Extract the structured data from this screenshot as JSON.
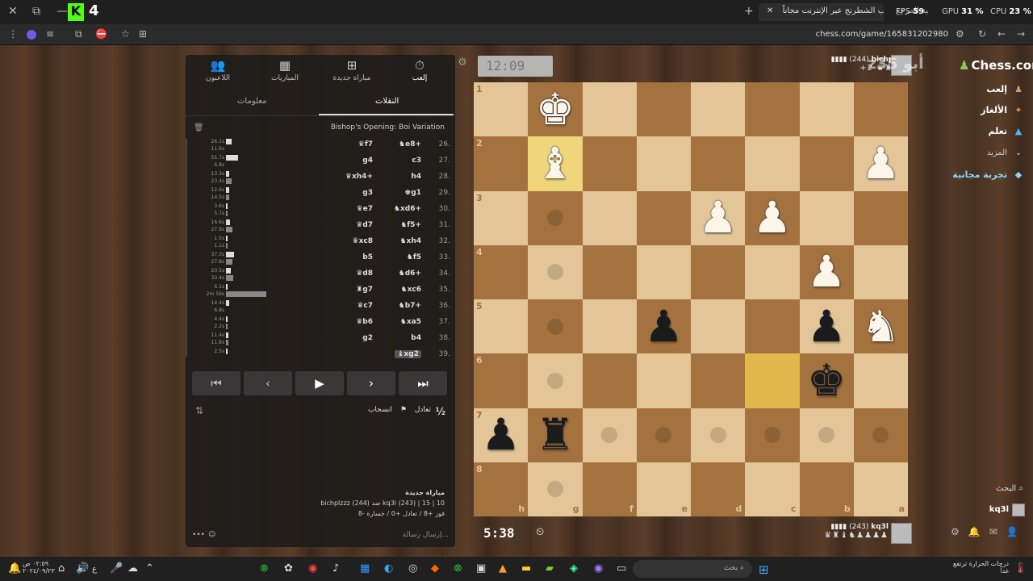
{
  "browser": {
    "tabs": [
      {
        "label": "إلعب الشطرنج عبر الإنترنت مجاناً"
      },
      {
        "label": "بنية المرجع"
      }
    ],
    "url": "chess.com/game/165831202980",
    "hud": {
      "fps_label": "FPS",
      "fps_value": "59",
      "gpu_label": "GPU",
      "gpu_value": "31 %",
      "cpu_label": "CPU",
      "cpu_value": "23 %"
    },
    "kick_badge": "4"
  },
  "panel": {
    "nav": [
      {
        "label": "إلعب",
        "icon": "timer-icon"
      },
      {
        "label": "مباراة جديدة",
        "icon": "plus-icon"
      },
      {
        "label": "المباريات",
        "icon": "board-icon"
      },
      {
        "label": "اللاعبون",
        "icon": "players-icon"
      }
    ],
    "subtabs": {
      "moves": "النقلات",
      "info": "معلومات"
    },
    "opening": "Bishop's Opening: Boi Variation",
    "moves": [
      {
        "no": "26.",
        "w": "♞e8+",
        "b": "♛f7"
      },
      {
        "no": "27.",
        "w": "c3",
        "b": "g4"
      },
      {
        "no": "28.",
        "w": "h4",
        "b": "♛xh4+"
      },
      {
        "no": "29.",
        "w": "♚g1",
        "b": "g3"
      },
      {
        "no": "30.",
        "w": "♞xd6+",
        "b": "♛e7"
      },
      {
        "no": "31.",
        "w": "♞f5+",
        "b": "♛d7"
      },
      {
        "no": "32.",
        "w": "♞xh4",
        "b": "♛xc8"
      },
      {
        "no": "33.",
        "w": "♞f5",
        "b": "b5"
      },
      {
        "no": "34.",
        "w": "♞d6+",
        "b": "♛d8"
      },
      {
        "no": "35.",
        "w": "♞xc6",
        "b": "♜g7"
      },
      {
        "no": "36.",
        "w": "♞b7+",
        "b": "♛c7"
      },
      {
        "no": "37.",
        "w": "♞xa5",
        "b": "♛b6"
      },
      {
        "no": "38.",
        "w": "b4",
        "b": "g2"
      },
      {
        "no": "39.",
        "w": "♝xg2",
        "b": ""
      }
    ],
    "times": [
      {
        "a": "26.1s",
        "b": "11.6s",
        "fa": 0.14,
        "fb": 0
      },
      {
        "a": "55.7s",
        "b": "6.8s",
        "fa": 0.3,
        "fb": 0
      },
      {
        "a": "13.3s",
        "b": "23.4s",
        "fa": 0.07,
        "fb": 0.13
      },
      {
        "a": "12.6s",
        "b": "14.5s",
        "fa": 0.07,
        "fb": 0.08
      },
      {
        "a": "3.6s",
        "b": "5.7s",
        "fa": 0.02,
        "fb": 0.03
      },
      {
        "a": "16.6s",
        "b": "27.9s",
        "fa": 0.09,
        "fb": 0.15
      },
      {
        "a": "1.5s",
        "b": "1.1s",
        "fa": 0.01,
        "fb": 0.01
      },
      {
        "a": "37.3s",
        "b": "27.8s",
        "fa": 0.2,
        "fb": 0.15
      },
      {
        "a": "20.5s",
        "b": "33.4s",
        "fa": 0.11,
        "fb": 0.18
      },
      {
        "a": "6.1s",
        "b": "2m 59s",
        "fa": 0.03,
        "fb": 1.0
      },
      {
        "a": "14.4s",
        "b": "6.8s",
        "fa": 0.08,
        "fb": 0
      },
      {
        "a": "4.4s",
        "b": "2.2s",
        "fa": 0.02,
        "fb": 0.01
      },
      {
        "a": "11.4s",
        "b": "11.8s",
        "fa": 0.06,
        "fb": 0.06
      },
      {
        "a": "2.5s",
        "b": "",
        "fa": 0.01,
        "fb": 0
      }
    ],
    "controls": {
      "first": "⏮",
      "prev": "‹",
      "play": "▶",
      "next": "›",
      "last": "⏭"
    },
    "draw_label": "تعادل",
    "draw_icon": "½",
    "resign_label": "انسحاب",
    "game_info": {
      "title": "مباراة جديدة",
      "line1": "bichplzzz (244) ضد kq3l (243) | 15 | 10",
      "line2": "فوز +8 / تعادل +0 / خسارة -8"
    },
    "chat_placeholder": "إرسال رسالة..."
  },
  "board": {
    "ranks": [
      "1",
      "2",
      "3",
      "4",
      "5",
      "6",
      "7",
      "8"
    ],
    "files": [
      "h",
      "g",
      "f",
      "e",
      "d",
      "c",
      "b",
      "a"
    ],
    "pieces": [
      {
        "sq": "0,1",
        "glyph": "♚",
        "color": "w"
      },
      {
        "sq": "1,1",
        "glyph": "♝",
        "color": "w"
      },
      {
        "sq": "1,7",
        "glyph": "♟",
        "color": "w"
      },
      {
        "sq": "2,4",
        "glyph": "♟",
        "color": "w"
      },
      {
        "sq": "2,5",
        "glyph": "♟",
        "color": "w"
      },
      {
        "sq": "3,6",
        "glyph": "♟",
        "color": "w"
      },
      {
        "sq": "4,3",
        "glyph": "♟",
        "color": "b"
      },
      {
        "sq": "4,6",
        "glyph": "♟",
        "color": "b"
      },
      {
        "sq": "4,7",
        "glyph": "♞",
        "color": "w"
      },
      {
        "sq": "5,6",
        "glyph": "♚",
        "color": "b"
      },
      {
        "sq": "6,0",
        "glyph": "♟",
        "color": "b"
      },
      {
        "sq": "6,1",
        "glyph": "♜",
        "color": "b"
      }
    ],
    "highlights": [
      "1,1",
      "5,5"
    ],
    "hints": [
      "2,1",
      "3,1",
      "4,1",
      "5,1",
      "6,2",
      "6,3",
      "6,4",
      "6,5",
      "6,6",
      "6,7",
      "7,1"
    ]
  },
  "players": {
    "top": {
      "name": "bichplzzz",
      "rating": "(244)",
      "material": "+2",
      "clock": "12:09"
    },
    "bottom": {
      "name": "kq3l",
      "rating": "(243)",
      "clock": "5:38"
    }
  },
  "sidebar": {
    "logo": "Chess.com",
    "items": [
      {
        "label": "إلعب",
        "icon": "pawn-icon"
      },
      {
        "label": "الألغاز",
        "icon": "puzzle-icon"
      },
      {
        "label": "تعلم",
        "icon": "cap-icon"
      },
      {
        "label": "المزيد",
        "icon": "chevron-icon"
      },
      {
        "label": "تجربة مجانية",
        "icon": "diamond-icon"
      }
    ],
    "search": "البحث",
    "username": "kq3l"
  },
  "watermark": "z35 أبو",
  "taskbar": {
    "search": "بحث",
    "weather_line1": "درجات الحرارة ترتفع",
    "weather_line2": "غداً",
    "time": "٠٢:٥٩ ص",
    "date": "٢٠٢٤/٠٩/٢٣",
    "lang": "ع"
  }
}
